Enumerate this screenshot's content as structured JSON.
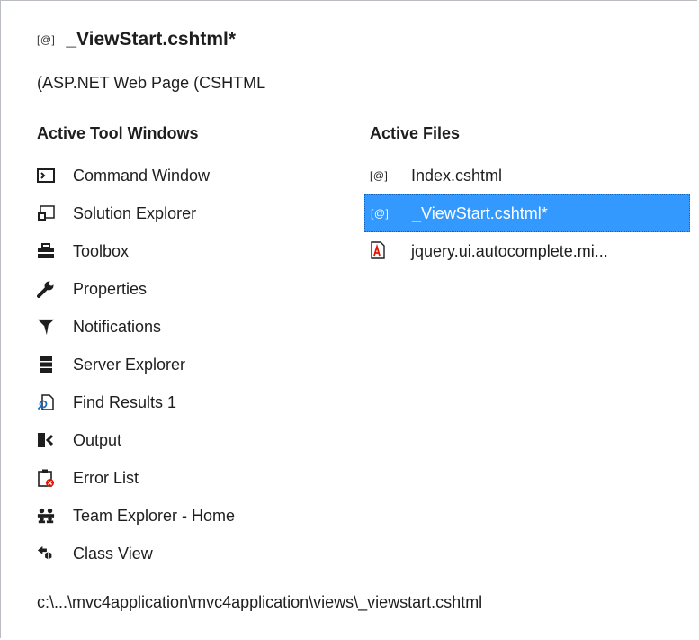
{
  "header": {
    "file_icon_glyph": "[@]",
    "title": "_ViewStart.cshtml*",
    "subtitle": "(ASP.NET Web Page (CSHTML"
  },
  "tool_windows": {
    "heading": "Active Tool Windows",
    "items": [
      {
        "label": "Command Window",
        "icon": "command-window-icon"
      },
      {
        "label": "Solution Explorer",
        "icon": "solution-explorer-icon"
      },
      {
        "label": "Toolbox",
        "icon": "toolbox-icon"
      },
      {
        "label": "Properties",
        "icon": "wrench-icon"
      },
      {
        "label": "Notifications",
        "icon": "notifications-flag-icon"
      },
      {
        "label": "Server Explorer",
        "icon": "server-icon"
      },
      {
        "label": "Find Results 1",
        "icon": "find-results-icon"
      },
      {
        "label": "Output",
        "icon": "output-icon"
      },
      {
        "label": "Error List",
        "icon": "error-list-icon"
      },
      {
        "label": "Team Explorer - Home",
        "icon": "team-explorer-icon"
      },
      {
        "label": "Class View",
        "icon": "class-view-icon"
      }
    ]
  },
  "active_files": {
    "heading": "Active Files",
    "items": [
      {
        "glyph": "[@]",
        "label": "Index.cshtml",
        "icon": "cshtml-file-icon",
        "selected": false
      },
      {
        "glyph": "[@]",
        "label": "_ViewStart.cshtml*",
        "icon": "cshtml-file-icon",
        "selected": true
      },
      {
        "glyph": "",
        "label": "jquery.ui.autocomplete.mi...",
        "icon": "javascript-file-icon",
        "selected": false
      }
    ]
  },
  "footer": {
    "path": "c:\\...\\mvc4application\\mvc4application\\views\\_viewstart.cshtml"
  },
  "colors": {
    "selection_background": "#3399ff",
    "selection_text": "#ffffff",
    "text": "#1e1e1e",
    "border": "#b9bcc0"
  }
}
